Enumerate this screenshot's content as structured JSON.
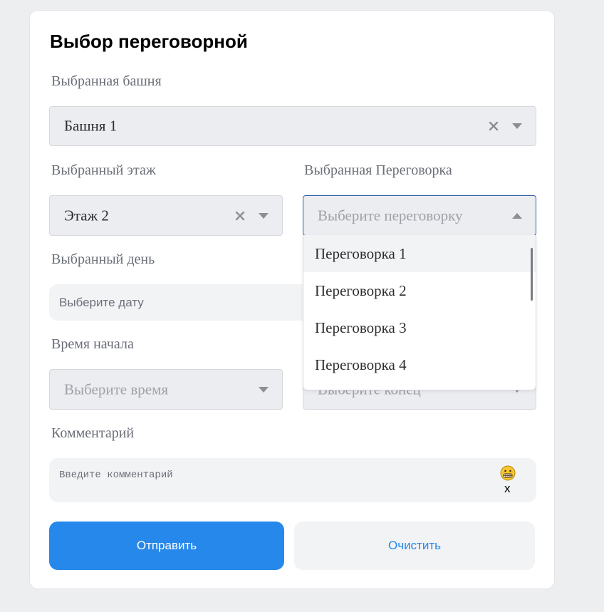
{
  "form": {
    "title": "Выбор переговорной",
    "tower": {
      "label": "Выбранная башня",
      "value": "Башня 1"
    },
    "floor": {
      "label": "Выбранный этаж",
      "value": "Этаж 2"
    },
    "room": {
      "label": "Выбранная Переговорка",
      "placeholder": "Выберите переговорку",
      "options": [
        "Переговорка 1",
        "Переговорка 2",
        "Переговорка 3",
        "Переговорка 4"
      ]
    },
    "day": {
      "label": "Выбранный день",
      "placeholder": "Выберите дату"
    },
    "start_time": {
      "label": "Время начала",
      "placeholder": "Выберите время"
    },
    "end_time": {
      "placeholder": "Выберите конец"
    },
    "comment": {
      "label": "Комментарий",
      "placeholder": "Введите комментарий",
      "x_mark": "x"
    },
    "buttons": {
      "submit": "Отправить",
      "clear": "Очистить"
    }
  },
  "colors": {
    "accent": "#2688eb",
    "field_bg": "#ebedf0",
    "focus_border": "#2d5fa8"
  },
  "icons": {
    "clear": "close-icon",
    "caret": "chevron-down-icon",
    "caret_open": "chevron-up-icon",
    "emoji": "grimacing-face-icon"
  }
}
